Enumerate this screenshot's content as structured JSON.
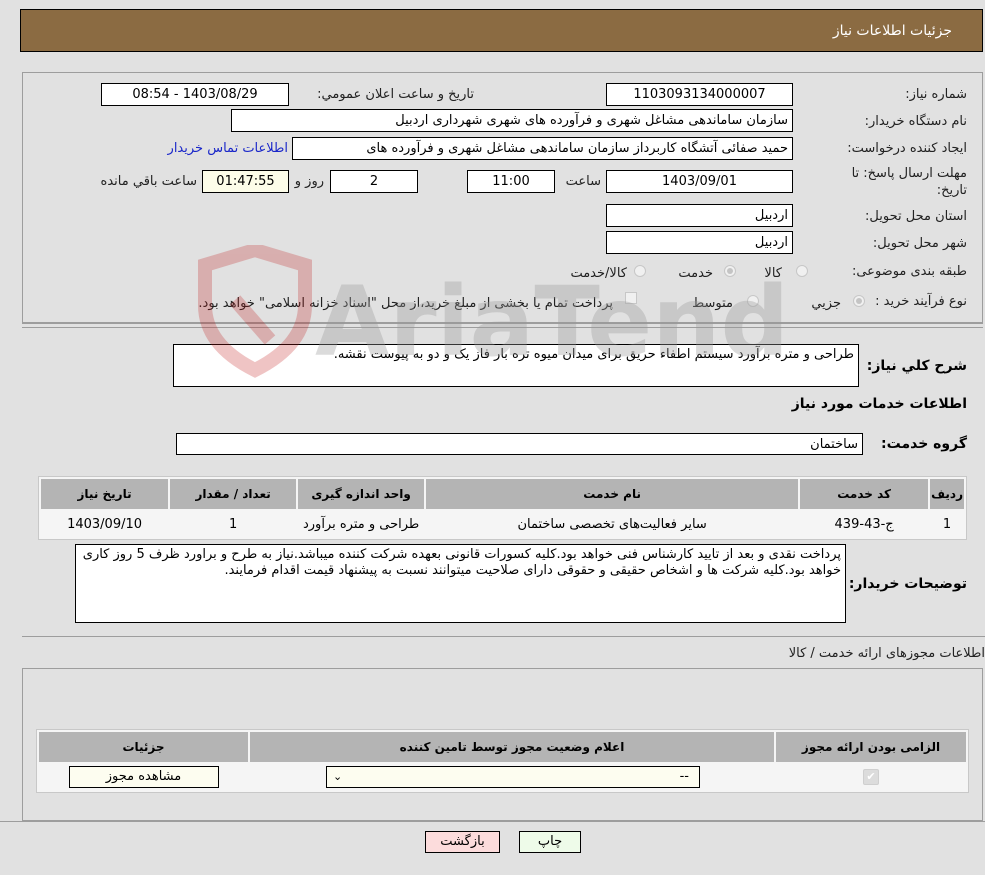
{
  "header": {
    "title": "جزئیات اطلاعات نیاز"
  },
  "form": {
    "need_number": {
      "label": "شماره نیاز:",
      "value": "1103093134000007"
    },
    "announce_datetime": {
      "label": "تاریخ و ساعت اعلان عمومي:",
      "value": "1403/08/29 - 08:54"
    },
    "buyer_org": {
      "label": "نام دستگاه خريدار:",
      "value": "سازمان ساماندهی مشاغل شهری و فرآورده های شهری شهرداری اردبیل"
    },
    "requester": {
      "label": "ایجاد کننده درخواست:",
      "value": "حمید صفائی آتشگاه کاربرداز سازمان ساماندهی مشاغل شهری و فرآورده های",
      "contact_link": "اطلاعات تماس خریدار"
    },
    "deadline": {
      "label": "مهلت ارسال پاسخ: تا تاریخ:",
      "date": "1403/09/01",
      "time_label": "ساعت",
      "time": "11:00",
      "days": "2",
      "days_label": "روز و",
      "remaining": "01:47:55",
      "remaining_label": "ساعت باقي مانده"
    },
    "province": {
      "label": "استان محل تحویل:",
      "value": "اردبیل"
    },
    "city": {
      "label": "شهر محل تحویل:",
      "value": "اردبیل"
    },
    "category": {
      "label": "طبقه بندی موضوعی:",
      "options": [
        "کالا",
        "خدمت",
        "کالا/خدمت"
      ],
      "selected": "خدمت"
    },
    "purchase_type": {
      "label": "نوع فرآیند خرید :",
      "options": [
        "جزيي",
        "متوسط"
      ],
      "selected": "جزيي",
      "treasury_note": "پرداخت تمام یا بخشی از مبلغ خرید،از محل \"اسناد خزانه اسلامی\" خواهد بود."
    }
  },
  "description": {
    "label": "شرح کلي نیاز:",
    "value": "طراحی و متره برآورد سیستم اطفاء حریق برای میدان میوه تره بار فاز یک و دو به پیوست نقشه."
  },
  "services": {
    "title": "اطلاعات خدمات مورد نیاز",
    "group_label": "گروه خدمت:",
    "group_value": "ساختمان",
    "columns": [
      "ردیف",
      "کد خدمت",
      "نام خدمت",
      "واحد اندازه گیری",
      "تعداد / مقدار",
      "تاریخ نیاز"
    ],
    "rows": [
      [
        "1",
        "ج-43-439",
        "سایر فعالیت‌های تخصصی ساختمان",
        "طراحی و متره برآورد",
        "1",
        "1403/09/10"
      ]
    ]
  },
  "buyer_notes": {
    "label": "توضیحات خریدار:",
    "value": "پرداخت نقدی و بعد از تایید کارشناس فنی خواهد بود.کلیه کسورات قانونی بعهده شرکت کننده میباشد.نیاز به طرح و براورد ظرف 5 روز کاری خواهد بود.کلیه شرکت ها و اشخاص حقیقی و حقوقی دارای صلاحیت میتوانند نسبت به پیشنهاد قیمت اقدام فرمایند."
  },
  "permits": {
    "title": "اطلاعات مجوزهای ارائه خدمت / کالا",
    "columns": [
      "الزامی بودن ارائه مجوز",
      "اعلام وضعیت مجوز توسط تامین کننده",
      "جزئیات"
    ],
    "row": {
      "required_checked": true,
      "status_value": "--",
      "details_button": "مشاهده مجوز"
    }
  },
  "buttons": {
    "print": "چاپ",
    "back": "بازگشت"
  },
  "watermark": {
    "text": "AriaTender.neT"
  }
}
